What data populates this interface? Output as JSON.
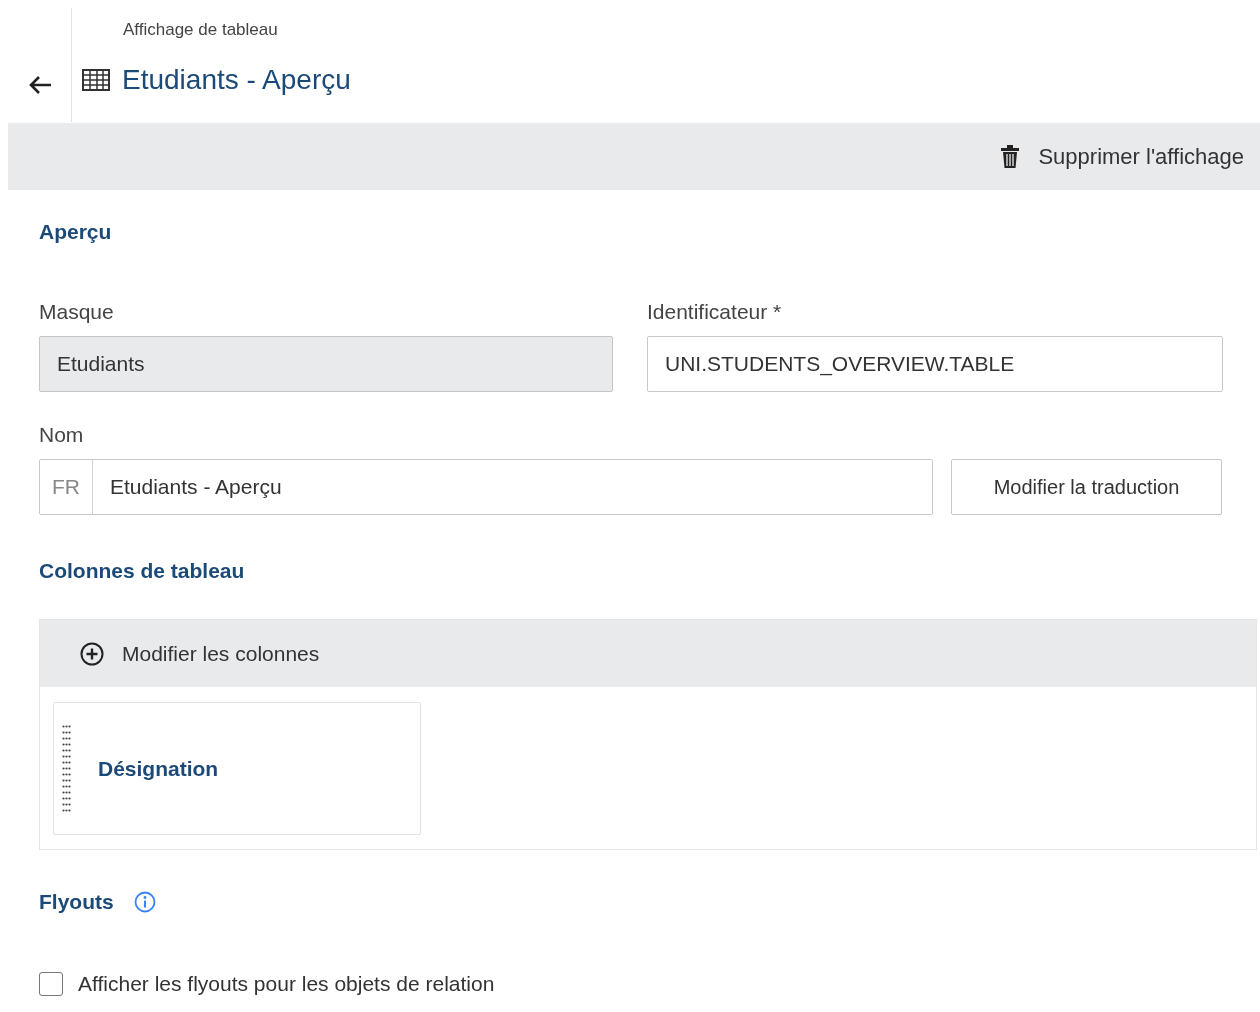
{
  "header": {
    "breadcrumb": "Affichage de tableau",
    "title": "Etudiants - Aperçu"
  },
  "toolbar": {
    "actions": [
      {
        "label": "Supprimer l'affichage"
      }
    ]
  },
  "overview": {
    "heading": "Aperçu",
    "fields": [
      {
        "label": "Masque",
        "value": "Etudiants",
        "disabled": true
      },
      {
        "label": "Identificateur",
        "required_mark": "*",
        "value": "UNI.STUDENTS_OVERVIEW.TABLE",
        "disabled": false
      }
    ],
    "name": {
      "label": "Nom",
      "language": "FR",
      "value": "Etudiants - Aperçu",
      "button": "Modifier la traduction"
    }
  },
  "columns": {
    "heading": "Colonnes de tableau",
    "edit_button": "Modifier les colonnes",
    "items": [
      {
        "label": "Désignation"
      }
    ]
  },
  "flyouts": {
    "heading": "Flyouts",
    "checkbox": {
      "label": "Afficher les flyouts pour les objets de relation",
      "checked": false
    }
  }
}
